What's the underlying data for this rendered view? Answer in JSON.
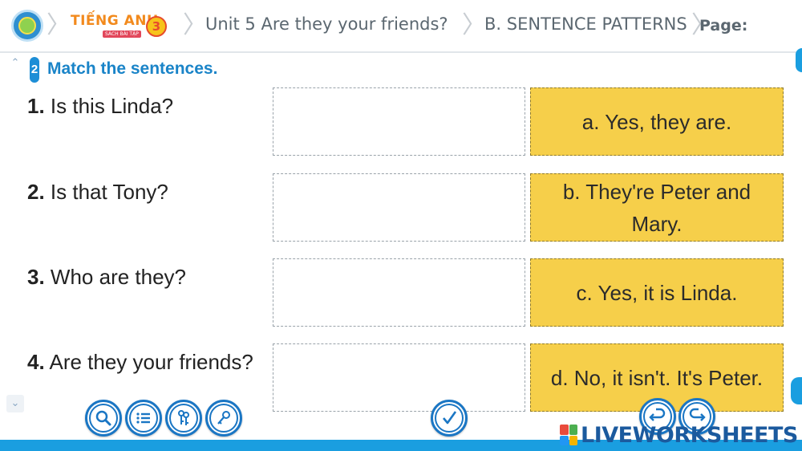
{
  "breadcrumb": {
    "brand_title": "TIẾNG ANH",
    "brand_sub": "SÁCH BÀI TẬP",
    "brand_grade": "3",
    "unit": "Unit 5 Are they your friends?",
    "section": "B. SENTENCE PATTERNS",
    "page_label": "Page:"
  },
  "exercise": {
    "number": "2",
    "title": "Match the sentences."
  },
  "questions": [
    {
      "num": "1.",
      "text": "Is this Linda?"
    },
    {
      "num": "2.",
      "text": "Is that Tony?"
    },
    {
      "num": "3.",
      "text": "Who are they?"
    },
    {
      "num": "4.",
      "text": "Are they your friends?"
    }
  ],
  "answers": [
    {
      "text": "a. Yes, they are."
    },
    {
      "text": "b. They're Peter and Mary."
    },
    {
      "text": "c. Yes, it is Linda."
    },
    {
      "text": "d. No, it isn't. It's Peter."
    }
  ],
  "toolbar": {
    "buttons": [
      "zoom-icon",
      "list-icon",
      "keys-icon",
      "key-icon",
      "check-icon",
      "undo-icon",
      "redo-icon"
    ]
  },
  "branding": {
    "liveworksheets": "LIVEWORKSHEETS"
  },
  "colors": {
    "accent_blue": "#1a84c8",
    "answer_yellow": "#f6cf4a",
    "toolbar_blue": "#1a76c4"
  }
}
